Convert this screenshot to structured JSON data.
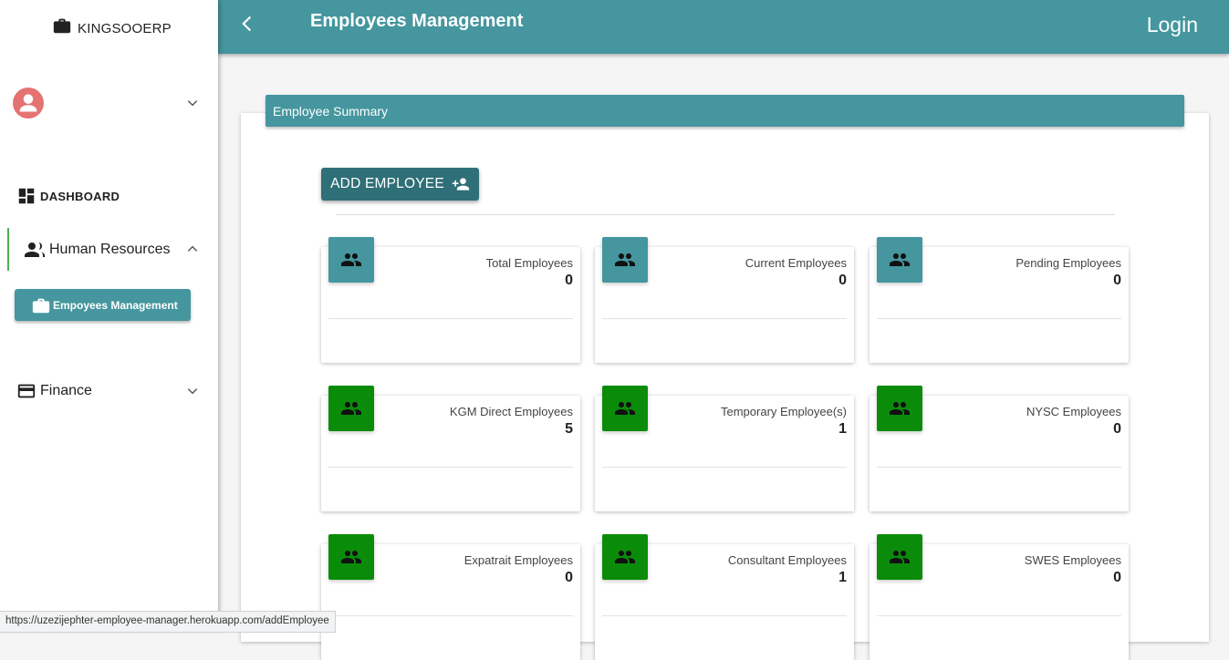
{
  "sidebar": {
    "brand": "KINGSOOERP",
    "dashboard_label": "DASHBOARD",
    "human_resources_label": "Human Resources",
    "employees_management_label": "Empoyees Management",
    "finance_label": "Finance"
  },
  "topbar": {
    "title": "Employees Management",
    "login_label": "Login"
  },
  "summary": {
    "header": "Employee Summary",
    "add_button_label": "ADD EMPLOYEE",
    "cards": [
      {
        "label": "Total Employees",
        "value": "0",
        "color": "#45969e"
      },
      {
        "label": "Current Employees",
        "value": "0",
        "color": "#45969e"
      },
      {
        "label": "Pending Employees",
        "value": "0",
        "color": "#45969e"
      },
      {
        "label": "KGM Direct Employees",
        "value": "5",
        "color": "#0a8c0a"
      },
      {
        "label": "Temporary Employee(s)",
        "value": "1",
        "color": "#0a8c0a"
      },
      {
        "label": "NYSC Employees",
        "value": "0",
        "color": "#0a8c0a"
      },
      {
        "label": "Expatrait Employees",
        "value": "0",
        "color": "#0a8c0a"
      },
      {
        "label": "Consultant Employees",
        "value": "1",
        "color": "#0a8c0a"
      },
      {
        "label": "SWES Employees",
        "value": "0",
        "color": "#0a8c0a"
      }
    ]
  },
  "statusbar": {
    "url": "https://uzezijephter-employee-manager.herokuapp.com/addEmployee"
  },
  "colors": {
    "primary": "#45969e",
    "primary_dark": "#2f6f77",
    "success": "#0a8c0a",
    "avatar": "#e57373"
  },
  "icons": [
    "briefcase-icon",
    "user-avatar-icon",
    "chevron-down-icon",
    "dashboard-icon",
    "people-icon",
    "chevron-up-icon",
    "credit-card-icon",
    "back-arrow-icon",
    "person-add-icon",
    "group-icon"
  ]
}
